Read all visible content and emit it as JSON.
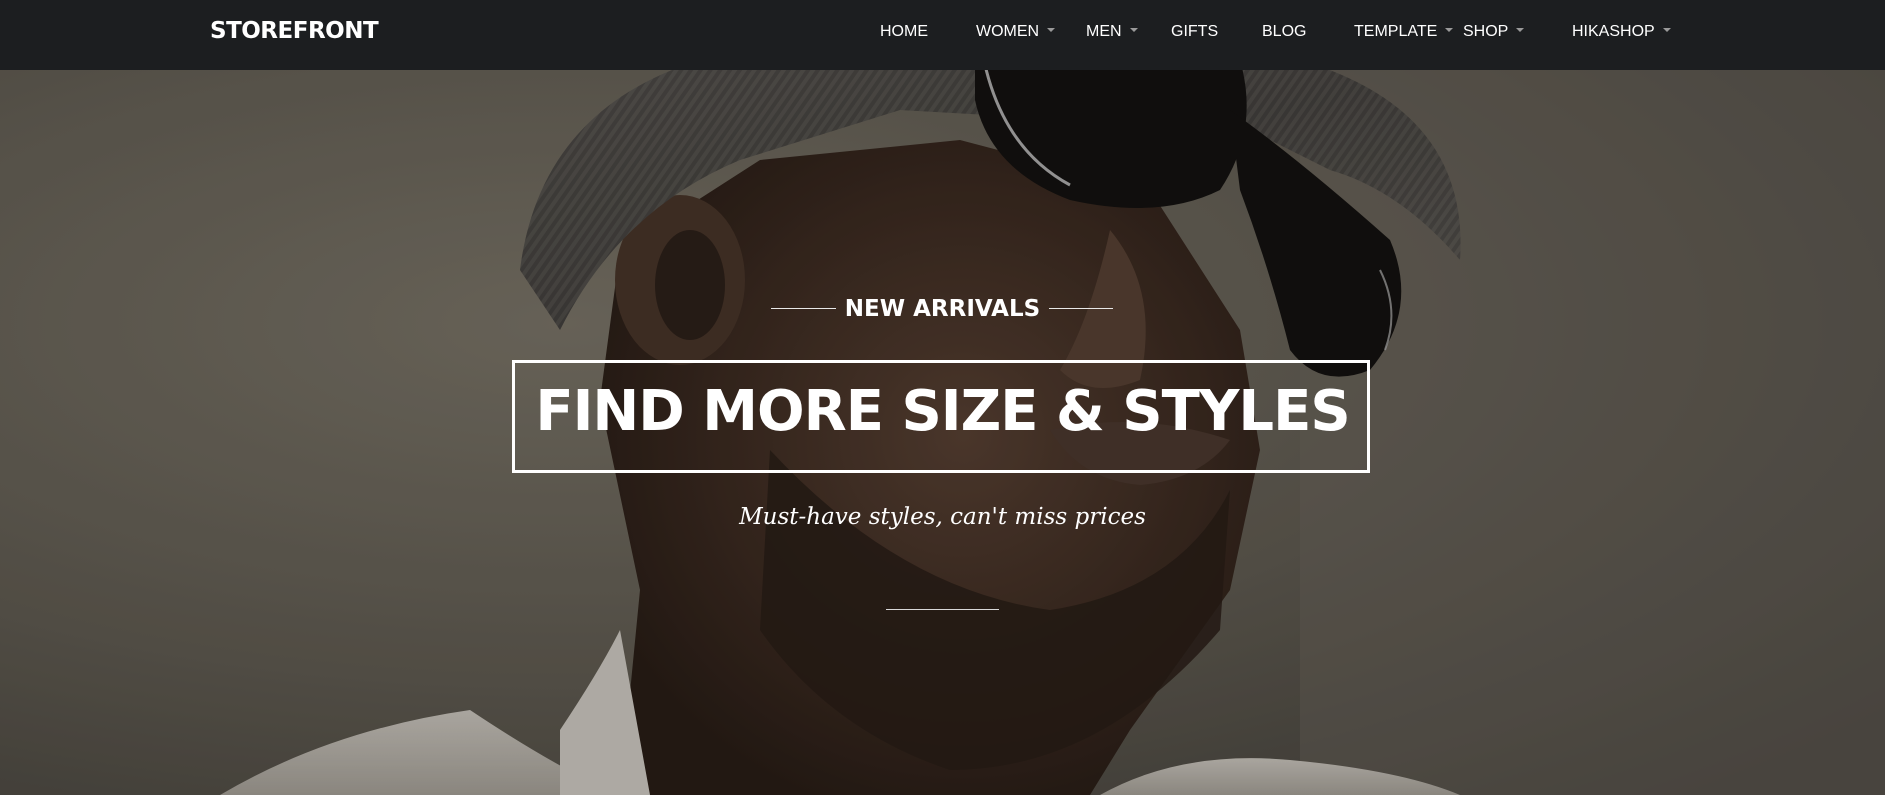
{
  "brand": {
    "name": "STOREFRONT"
  },
  "nav": {
    "items": [
      {
        "label": "HOME",
        "has_dropdown": false
      },
      {
        "label": "WOMEN",
        "has_dropdown": true
      },
      {
        "label": "MEN",
        "has_dropdown": true
      },
      {
        "label": "GIFTS",
        "has_dropdown": false
      },
      {
        "label": "BLOG",
        "has_dropdown": false
      },
      {
        "label": "TEMPLATE",
        "has_dropdown": true
      },
      {
        "label": "SHOP",
        "has_dropdown": true
      },
      {
        "label": "HIKASHOP",
        "has_dropdown": true
      }
    ]
  },
  "hero": {
    "eyebrow": "NEW ARRIVALS",
    "headline": "FIND MORE SIZE & STYLES",
    "subline": "Must-have styles, can't miss prices"
  },
  "colors": {
    "navbar_bg": "#1c1e20",
    "text": "#ffffff",
    "caret": "#9a9a9a"
  }
}
